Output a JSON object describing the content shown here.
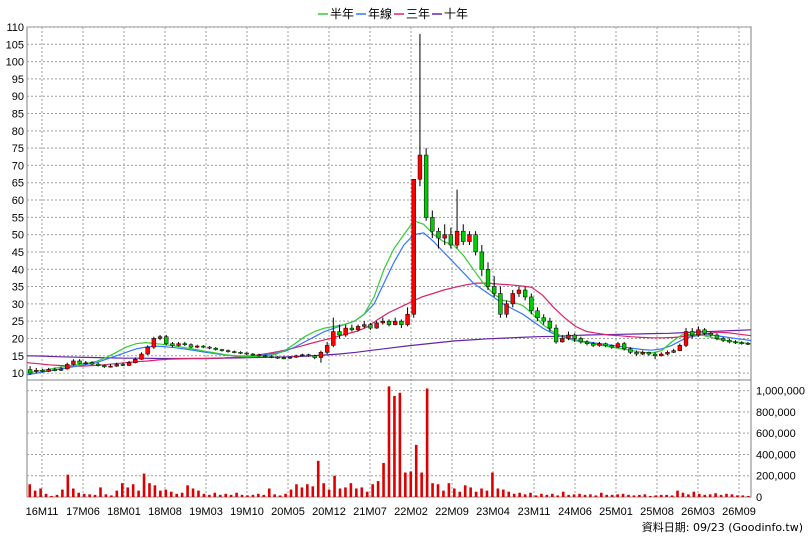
{
  "legend": [
    {
      "name": "半年",
      "color": "#33cc33"
    },
    {
      "name": "年線",
      "color": "#3377ff"
    },
    {
      "name": "三年",
      "color": "#dd2266"
    },
    {
      "name": "十年",
      "color": "#6622aa"
    }
  ],
  "footer": "資料日期: 09/23  (Goodinfo.tw)",
  "colors": {
    "up": "#ff0000",
    "down": "#00cc00",
    "volume": "#dd0000",
    "grid": "#a0a0a0",
    "frame": "#808080"
  },
  "chart_data": [
    {
      "type": "candlestick",
      "ylim": [
        8,
        110
      ],
      "y_ticks": [
        10,
        15,
        20,
        25,
        30,
        35,
        40,
        45,
        50,
        55,
        60,
        65,
        70,
        75,
        80,
        85,
        90,
        95,
        100,
        105,
        110
      ],
      "x_ticks": [
        "16M11",
        "17M06",
        "18M01",
        "18M08",
        "19M03",
        "19M10",
        "20M05",
        "20M12",
        "21M07",
        "22M02",
        "22M09",
        "23M04",
        "23M11",
        "24M06",
        "25M01",
        "25M08",
        "26M03",
        "26M09"
      ],
      "grid": true,
      "legend_position": "top-center",
      "candles": [
        [
          11,
          10,
          12,
          9.5
        ],
        [
          10.5,
          10.8,
          11.5,
          10
        ],
        [
          10.8,
          10.5,
          11.2,
          10.2
        ],
        [
          10.5,
          11,
          11.5,
          10.3
        ],
        [
          11,
          10.8,
          11.6,
          10.5
        ],
        [
          10.8,
          11.2,
          11.8,
          10.6
        ],
        [
          11.2,
          12.5,
          13,
          11
        ],
        [
          12.5,
          13.5,
          14,
          12.2
        ],
        [
          13.5,
          12.8,
          14,
          12.5
        ],
        [
          12.8,
          13,
          13.5,
          12.4
        ],
        [
          13,
          12.6,
          13.4,
          12.3
        ],
        [
          12.6,
          12.2,
          13,
          11.9
        ],
        [
          12.2,
          11.8,
          12.5,
          11.5
        ],
        [
          11.8,
          12,
          12.6,
          11.6
        ],
        [
          12,
          12.5,
          13,
          11.8
        ],
        [
          12.5,
          12.2,
          13,
          12
        ],
        [
          12.2,
          13,
          13.5,
          12
        ],
        [
          13,
          14,
          14.5,
          12.8
        ],
        [
          14,
          15.5,
          16,
          13.8
        ],
        [
          15.5,
          17.5,
          18,
          15.2
        ],
        [
          17.5,
          20,
          20.5,
          17
        ],
        [
          20,
          20.5,
          21,
          19.5
        ],
        [
          20.5,
          18.5,
          21,
          18
        ],
        [
          18.5,
          18,
          19,
          17.5
        ],
        [
          18,
          18.5,
          19,
          17.7
        ],
        [
          18.5,
          18.2,
          19,
          17.8
        ],
        [
          18.2,
          17.5,
          18.6,
          17.2
        ],
        [
          17.5,
          17.8,
          18.2,
          17.2
        ],
        [
          17.8,
          17.5,
          18.1,
          17.2
        ],
        [
          17.5,
          17.2,
          17.8,
          16.9
        ],
        [
          17.2,
          16.8,
          17.5,
          16.5
        ],
        [
          16.8,
          16.5,
          17,
          16.2
        ],
        [
          16.5,
          16.2,
          16.8,
          15.9
        ],
        [
          16.2,
          16,
          16.5,
          15.7
        ],
        [
          16,
          15.8,
          16.3,
          15.5
        ],
        [
          15.8,
          15.5,
          16,
          15.2
        ],
        [
          15.5,
          15.3,
          15.8,
          15
        ],
        [
          15.3,
          15,
          15.6,
          14.7
        ],
        [
          15,
          14.8,
          15.3,
          14.5
        ],
        [
          14.8,
          14.6,
          15.1,
          14.3
        ],
        [
          14.6,
          14.4,
          14.9,
          14.1
        ],
        [
          14.4,
          14.3,
          14.7,
          14
        ],
        [
          14.3,
          14.6,
          14.9,
          14.1
        ],
        [
          14.6,
          15,
          15.3,
          14.4
        ],
        [
          15,
          15.3,
          15.6,
          14.8
        ],
        [
          15.3,
          15,
          15.6,
          14.7
        ],
        [
          15,
          14.5,
          15.3,
          14
        ],
        [
          14.5,
          16,
          16.5,
          13
        ],
        [
          16,
          18,
          19,
          15.5
        ],
        [
          18,
          22,
          26,
          17.5
        ],
        [
          22,
          21,
          24,
          20
        ],
        [
          21,
          23,
          24,
          20.5
        ],
        [
          23,
          22.5,
          24,
          22
        ],
        [
          22.5,
          23.5,
          24,
          22
        ],
        [
          23.5,
          24,
          25,
          23
        ],
        [
          24,
          23,
          24.5,
          22.5
        ],
        [
          23,
          24.5,
          25,
          22.8
        ],
        [
          24.5,
          25,
          26,
          24
        ],
        [
          25,
          24,
          25.5,
          23.5
        ],
        [
          24,
          25,
          26,
          23.8
        ],
        [
          25,
          24,
          25.5,
          23
        ],
        [
          24,
          27,
          29,
          23.5
        ],
        [
          27,
          66,
          66,
          26
        ],
        [
          66,
          73,
          108,
          64
        ],
        [
          73,
          55,
          75,
          54
        ],
        [
          55,
          51,
          57,
          49
        ],
        [
          51,
          49,
          52,
          46
        ],
        [
          49,
          50,
          53,
          47
        ],
        [
          50,
          47,
          52,
          46
        ],
        [
          47,
          51,
          63,
          46
        ],
        [
          51,
          48,
          53,
          47
        ],
        [
          48,
          50,
          51,
          47
        ],
        [
          50,
          45,
          51,
          44
        ],
        [
          45,
          40,
          47,
          38
        ],
        [
          40,
          35,
          42,
          34
        ],
        [
          35,
          33,
          38,
          32
        ],
        [
          33,
          27,
          35,
          26
        ],
        [
          27,
          30,
          31,
          26
        ],
        [
          30,
          33,
          34,
          29
        ],
        [
          33,
          34,
          35,
          32
        ],
        [
          34,
          32,
          35,
          31
        ],
        [
          32,
          28,
          33,
          27
        ],
        [
          28,
          26,
          29,
          25
        ],
        [
          26,
          25,
          27,
          24
        ],
        [
          25,
          23,
          26,
          22
        ],
        [
          23,
          19,
          24,
          18.5
        ],
        [
          19,
          20,
          21,
          18.8
        ],
        [
          20,
          21,
          22,
          19.5
        ],
        [
          21,
          20,
          21.5,
          19
        ],
        [
          20,
          19,
          20.5,
          18.5
        ],
        [
          19,
          18.5,
          19.5,
          18
        ],
        [
          18.5,
          18,
          19,
          17.5
        ],
        [
          18,
          18.5,
          19,
          17.6
        ],
        [
          18.5,
          18,
          18.8,
          17.5
        ],
        [
          18,
          17.5,
          18.3,
          17
        ],
        [
          17.5,
          18.5,
          19,
          17.2
        ],
        [
          18.5,
          17,
          19,
          16.5
        ],
        [
          17,
          16,
          17.5,
          15.5
        ],
        [
          16,
          15.5,
          16.5,
          15
        ],
        [
          15.5,
          16,
          16.5,
          15.2
        ],
        [
          16,
          15.5,
          16.2,
          15
        ],
        [
          15.5,
          15,
          16,
          14
        ],
        [
          15,
          15.5,
          16,
          14.8
        ],
        [
          15.5,
          16,
          16.5,
          15.2
        ],
        [
          16,
          16.5,
          17,
          15.8
        ],
        [
          16.5,
          18,
          18.5,
          16.3
        ],
        [
          18,
          22,
          23,
          17.5
        ],
        [
          22,
          21,
          23,
          20
        ],
        [
          21,
          22.5,
          23.5,
          20.5
        ],
        [
          22.5,
          21.5,
          23,
          21
        ],
        [
          21.5,
          21,
          22,
          20.5
        ],
        [
          21,
          20,
          21.5,
          19.5
        ],
        [
          20,
          19.5,
          20.5,
          19
        ],
        [
          19.5,
          19,
          20,
          18.6
        ],
        [
          19,
          18.8,
          19.5,
          18.4
        ],
        [
          18.8,
          18.6,
          19.2,
          18.2
        ],
        [
          18.6,
          18.5,
          19,
          18.1
        ]
      ],
      "ma_half_year": [
        10,
        10.5,
        11,
        11.5,
        12,
        12.4,
        12.8,
        13.4,
        14.5,
        16,
        17.5,
        18.5,
        18.8,
        18.5,
        18.2,
        17.8,
        17.3,
        16.8,
        16.3,
        15.8,
        15.3,
        15,
        14.8,
        14.8,
        15,
        15.3,
        16.5,
        18.5,
        20.5,
        22,
        23,
        23.5,
        24,
        25,
        27,
        32,
        40,
        46,
        50,
        54,
        53,
        50,
        48,
        47,
        44,
        40,
        36,
        33,
        31,
        30.5,
        29.5,
        27,
        24,
        22,
        20.5,
        19.5,
        19,
        18.5,
        18,
        17.5,
        17,
        16.5,
        16,
        15.8,
        16.5,
        19,
        21,
        21.2,
        21,
        20.3,
        19.6,
        19.2,
        18.8,
        18.5
      ],
      "ma_year": [
        9.5,
        10,
        10.5,
        11,
        11.5,
        12,
        12.5,
        13,
        14,
        15,
        16,
        17,
        17.5,
        17.8,
        17.6,
        17.3,
        16.9,
        16.5,
        16,
        15.6,
        15.2,
        15,
        14.9,
        15,
        15.3,
        15.7,
        16.3,
        17.5,
        19,
        20.5,
        22,
        23,
        24,
        25,
        27,
        30,
        36,
        42,
        47,
        50,
        50.5,
        48,
        45,
        42,
        39,
        36,
        34,
        32,
        30,
        28.5,
        27,
        25,
        23,
        21.5,
        20.5,
        19.8,
        19.2,
        18.8,
        18.4,
        18,
        17.6,
        17.2,
        16.8,
        16.6,
        17,
        18,
        19.5,
        20.5,
        21,
        21,
        20.6,
        20.2,
        19.8,
        19.4
      ],
      "ma_3year": [
        13,
        12.7,
        12.4,
        12.2,
        12,
        12,
        12.2,
        12.4,
        12.7,
        13,
        13.3,
        13.5,
        13.8,
        14,
        14.1,
        14.2,
        14.2,
        14.3,
        14.4,
        14.6,
        14.8,
        15.2,
        15.7,
        16.3,
        17,
        17.8,
        18.7,
        19.5,
        20.3,
        21.2,
        22,
        23.3,
        25.5,
        27.5,
        29,
        30.5,
        32,
        33,
        34,
        34.8,
        35.5,
        36,
        36,
        35.7,
        35.5,
        35.2,
        34.8,
        32.5,
        29,
        26,
        23.5,
        22,
        21.5,
        21,
        20.8,
        20.5,
        20.3,
        20.2,
        20.2,
        20.3,
        20.6,
        21,
        21.4,
        21.8,
        21.6,
        21.2,
        20.8
      ],
      "ma_10year": [
        15,
        14.9,
        14.7,
        14.6,
        14.5,
        14.4,
        14.3,
        14.3,
        14.2,
        14.2,
        14.2,
        14.2,
        14.3,
        14.4,
        14.5,
        14.6,
        14.7,
        14.9,
        15.2,
        15.5,
        16,
        16.6,
        17.2,
        17.8,
        18.3,
        18.8,
        19.3,
        19.6,
        19.9,
        20.1,
        20.3,
        20.5,
        20.6,
        20.8,
        21,
        21.1,
        21.2,
        21.3,
        21.4,
        21.5,
        21.7,
        21.9,
        22.1,
        22.3,
        22.5
      ]
    },
    {
      "type": "bar",
      "series_name": "volume",
      "ylim": [
        0,
        1100000
      ],
      "y_ticks": [
        0,
        200000,
        400000,
        600000,
        800000,
        1000000
      ],
      "y_tick_labels": [
        "0",
        "200,000",
        "400,000",
        "600,000",
        "800,000",
        "1,000,000"
      ],
      "values": [
        120000,
        60000,
        80000,
        30000,
        10000,
        20000,
        70000,
        210000,
        80000,
        40000,
        30000,
        25000,
        20000,
        90000,
        25000,
        15000,
        60000,
        130000,
        90000,
        120000,
        60000,
        220000,
        130000,
        110000,
        60000,
        70000,
        50000,
        30000,
        40000,
        110000,
        80000,
        60000,
        30000,
        20000,
        40000,
        20000,
        30000,
        20000,
        40000,
        20000,
        15000,
        20000,
        30000,
        20000,
        80000,
        25000,
        15000,
        30000,
        70000,
        120000,
        90000,
        120000,
        100000,
        340000,
        130000,
        70000,
        200000,
        80000,
        90000,
        130000,
        80000,
        90000,
        50000,
        120000,
        150000,
        320000,
        1040000,
        950000,
        980000,
        230000,
        240000,
        490000,
        230000,
        1020000,
        130000,
        120000,
        60000,
        130000,
        80000,
        50000,
        110000,
        90000,
        50000,
        80000,
        60000,
        230000,
        80000,
        70000,
        50000,
        30000,
        40000,
        25000,
        40000,
        15000,
        30000,
        20000,
        30000,
        15000,
        50000,
        20000,
        25000,
        30000,
        20000,
        25000,
        15000,
        40000,
        20000,
        20000,
        25000,
        30000,
        20000,
        15000,
        20000,
        25000,
        10000,
        15000,
        20000,
        20000,
        15000,
        60000,
        40000,
        25000,
        50000,
        30000,
        20000,
        25000,
        35000,
        20000,
        30000,
        25000,
        15000,
        15000,
        10000
      ]
    }
  ]
}
